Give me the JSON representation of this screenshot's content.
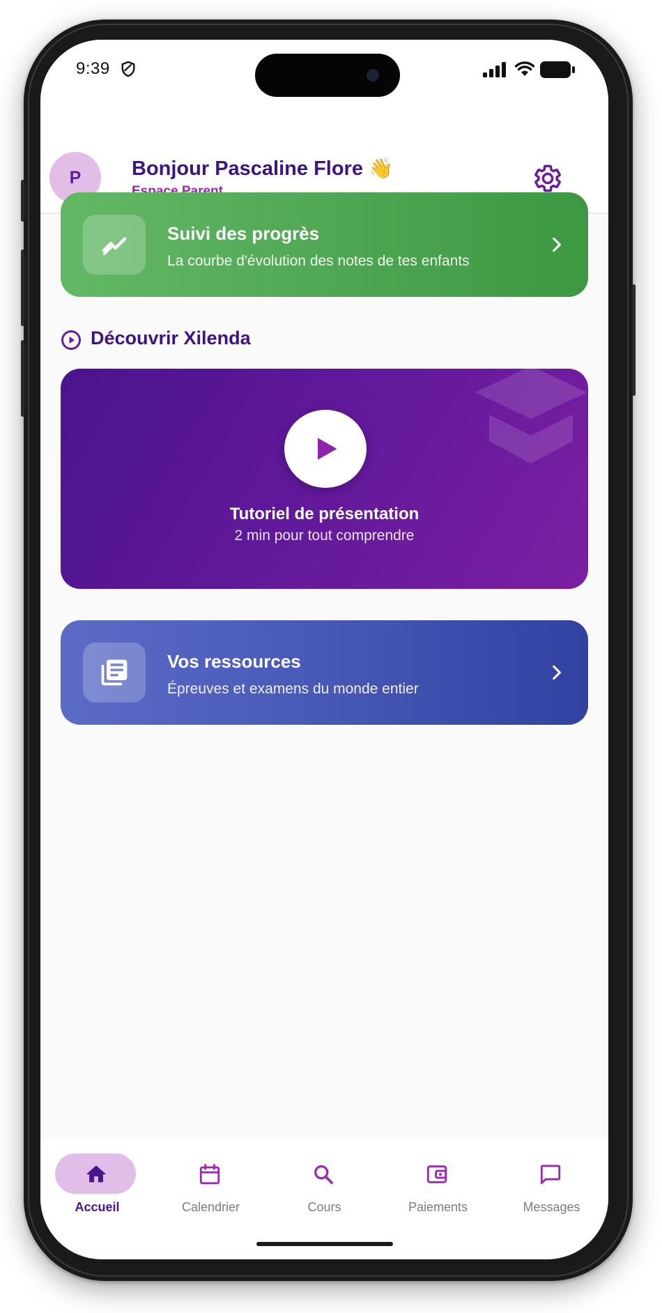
{
  "status_bar": {
    "time": "9:39",
    "icons": [
      "shield-icon",
      "signal-icon",
      "wifi-icon",
      "battery-icon"
    ]
  },
  "header": {
    "avatar_initial": "P",
    "greeting": "Bonjour Pascaline Flore",
    "greeting_emoji": "👋",
    "subtitle": "Espace Parent",
    "settings_icon": "gear-icon"
  },
  "progress_card": {
    "title": "Suivi des progrès",
    "subtitle": "La courbe d'évolution des notes de tes enfants",
    "icon": "trending-up-icon",
    "color": "#4fa652"
  },
  "section": {
    "title": "Découvrir Xilenda",
    "icon": "play-circle-icon"
  },
  "video_card": {
    "title": "Tutoriel de présentation",
    "subtitle": "2 min pour tout comprendre",
    "icon": "play-icon",
    "decoration": "graduation-cap-icon",
    "color": "#6a1b9a"
  },
  "resources_card": {
    "title": "Vos ressources",
    "subtitle": "Épreuves et examens du monde entier",
    "icon": "library-books-icon",
    "color": "#4556b4"
  },
  "bottom_nav": {
    "items": [
      {
        "label": "Accueil",
        "icon": "home-icon",
        "active": true
      },
      {
        "label": "Calendrier",
        "icon": "calendar-icon",
        "active": false
      },
      {
        "label": "Cours",
        "icon": "search-icon",
        "active": false
      },
      {
        "label": "Paiements",
        "icon": "wallet-icon",
        "active": false
      },
      {
        "label": "Messages",
        "icon": "chat-icon",
        "active": false
      }
    ]
  },
  "colors": {
    "primary": "#4a148c",
    "accent": "#9c27b0",
    "avatar_bg": "#e1bee7"
  }
}
